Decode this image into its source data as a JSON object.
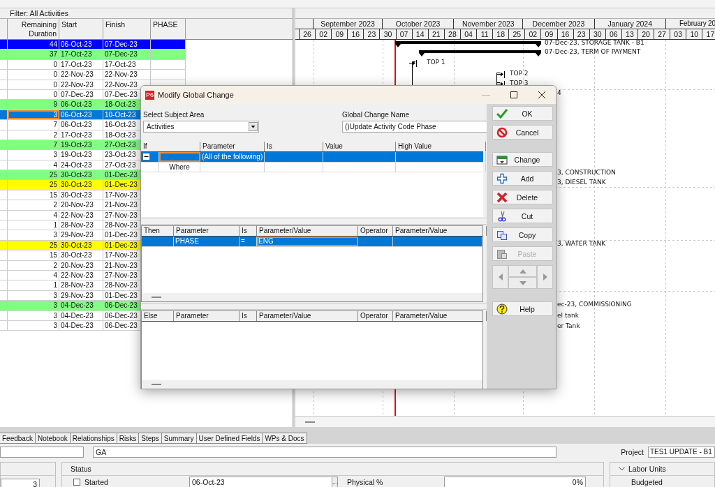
{
  "filter_bar": {
    "label": "Filter: All Activities"
  },
  "table": {
    "columns": [
      {
        "label": "Remaining Duration"
      },
      {
        "label": "Start"
      },
      {
        "label": "Finish"
      },
      {
        "label": "PHASE"
      }
    ],
    "rows": [
      {
        "remaining": "44",
        "start": "06-Oct-23",
        "finish": "07-Dec-23",
        "color": "#0000ff",
        "selected": false
      },
      {
        "remaining": "37",
        "start": "17-Oct-23",
        "finish": "07-Dec-23",
        "color": "#80ff80",
        "selected": false
      },
      {
        "remaining": "0",
        "start": "17-Oct-23",
        "finish": "17-Oct-23",
        "selected": false
      },
      {
        "remaining": "0",
        "start": "22-Nov-23",
        "finish": "22-Nov-23",
        "selected": false
      },
      {
        "remaining": "0",
        "start": "22-Nov-23",
        "finish": "22-Nov-23",
        "selected": false
      },
      {
        "remaining": "0",
        "start": "07-Dec-23",
        "finish": "07-Dec-23",
        "selected": false
      },
      {
        "remaining": "9",
        "start": "06-Oct-23",
        "finish": "18-Oct-23",
        "color": "#80ff80",
        "selected": false
      },
      {
        "remaining": "3",
        "start": "06-Oct-23",
        "finish": "10-Oct-23",
        "selected": true
      },
      {
        "remaining": "7",
        "start": "06-Oct-23",
        "finish": "16-Oct-23",
        "selected": false
      },
      {
        "remaining": "2",
        "start": "17-Oct-23",
        "finish": "18-Oct-23",
        "selected": false
      },
      {
        "remaining": "7",
        "start": "19-Oct-23",
        "finish": "27-Oct-23",
        "color": "#80ff80",
        "selected": false
      },
      {
        "remaining": "3",
        "start": "19-Oct-23",
        "finish": "23-Oct-23",
        "selected": false
      },
      {
        "remaining": "4",
        "start": "24-Oct-23",
        "finish": "27-Oct-23",
        "selected": false
      },
      {
        "remaining": "25",
        "start": "30-Oct-23",
        "finish": "01-Dec-23",
        "color": "#80ff80",
        "selected": false
      },
      {
        "remaining": "25",
        "start": "30-Oct-23",
        "finish": "01-Dec-23",
        "color": "#ffff00",
        "selected": false
      },
      {
        "remaining": "15",
        "start": "30-Oct-23",
        "finish": "17-Nov-23",
        "selected": false
      },
      {
        "remaining": "2",
        "start": "20-Nov-23",
        "finish": "21-Nov-23",
        "selected": false
      },
      {
        "remaining": "4",
        "start": "22-Nov-23",
        "finish": "27-Nov-23",
        "selected": false
      },
      {
        "remaining": "1",
        "start": "28-Nov-23",
        "finish": "28-Nov-23",
        "selected": false
      },
      {
        "remaining": "3",
        "start": "29-Nov-23",
        "finish": "01-Dec-23",
        "selected": false
      },
      {
        "remaining": "25",
        "start": "30-Oct-23",
        "finish": "01-Dec-23",
        "color": "#ffff00",
        "selected": false
      },
      {
        "remaining": "15",
        "start": "30-Oct-23",
        "finish": "17-Nov-23",
        "selected": false
      },
      {
        "remaining": "2",
        "start": "20-Nov-23",
        "finish": "21-Nov-23",
        "selected": false
      },
      {
        "remaining": "4",
        "start": "22-Nov-23",
        "finish": "27-Nov-23",
        "selected": false
      },
      {
        "remaining": "1",
        "start": "28-Nov-23",
        "finish": "28-Nov-23",
        "selected": false
      },
      {
        "remaining": "3",
        "start": "29-Nov-23",
        "finish": "01-Dec-23",
        "selected": false
      },
      {
        "remaining": "3",
        "start": "04-Dec-23",
        "finish": "06-Dec-23",
        "color": "#80ff80",
        "selected": false
      },
      {
        "remaining": "3",
        "start": "04-Dec-23",
        "finish": "06-Dec-23",
        "selected": false
      },
      {
        "remaining": "3",
        "start": "04-Dec-23",
        "finish": "06-Dec-23",
        "selected": false
      }
    ]
  },
  "gantt": {
    "months": [
      "September 2023",
      "October 2023",
      "November 2023",
      "December 2023",
      "January 2024",
      "February 20"
    ],
    "weeks": [
      "26",
      "02",
      "09",
      "16",
      "23",
      "30",
      "07",
      "14",
      "21",
      "28",
      "04",
      "11",
      "18",
      "25",
      "02",
      "09",
      "16",
      "23",
      "30",
      "06",
      "13",
      "20",
      "27",
      "03",
      "10",
      "17"
    ],
    "items": [
      {
        "kind": "summary",
        "label": "07-Dec-23, STORAGE TANK - B1"
      },
      {
        "kind": "summary",
        "label": "07-Dec-23, TERM OF PAYMENT"
      },
      {
        "kind": "milestone",
        "label": "TOP 1"
      },
      {
        "kind": "milestone",
        "label": "TOP 2"
      },
      {
        "kind": "milestone",
        "label": "TOP 3"
      },
      {
        "kind": "label",
        "label": "4"
      },
      {
        "kind": "label",
        "label": "3, CONSTRUCTION"
      },
      {
        "kind": "label",
        "label": "3, DIESEL TANK"
      },
      {
        "kind": "label",
        "label": "3, WATER TANK"
      },
      {
        "kind": "label",
        "label": "ec-23, COMMISSIONING"
      },
      {
        "kind": "label",
        "label": "el tank"
      },
      {
        "kind": "label",
        "label": "er Tank"
      }
    ]
  },
  "dialog": {
    "app_badge": "P6",
    "title": "Modify Global Change",
    "subject_area": {
      "label": "Select Subject Area",
      "value": "Activities"
    },
    "name_field": {
      "label": "Global Change Name",
      "value": "()Update Activity Code Phase"
    },
    "if_grid": {
      "columns": [
        "If",
        "Parameter",
        "Is",
        "Value",
        "High Value"
      ],
      "rows": [
        {
          "kind": "group",
          "expanded": true,
          "selected": true,
          "parameter": "(All of the following)"
        },
        {
          "kind": "condition",
          "selected": false,
          "label": "Where"
        }
      ]
    },
    "then_grid": {
      "columns": [
        "Then",
        "Parameter",
        "Is",
        "Parameter/Value",
        "Operator",
        "Parameter/Value"
      ],
      "rows": [
        {
          "selected": true,
          "parameter": "PHASE",
          "is": "=",
          "value": "ENG"
        }
      ]
    },
    "else_grid": {
      "columns": [
        "Else",
        "Parameter",
        "Is",
        "Parameter/Value",
        "Operator",
        "Parameter/Value"
      ]
    },
    "buttons_top": [
      {
        "kind": "ok",
        "label": "OK",
        "disabled": false
      },
      {
        "kind": "cancel",
        "label": "Cancel",
        "disabled": false
      }
    ],
    "buttons_edit": [
      {
        "kind": "change",
        "label": "Change",
        "disabled": false
      },
      {
        "kind": "add",
        "label": "Add",
        "disabled": false
      },
      {
        "kind": "delete",
        "label": "Delete",
        "disabled": false
      },
      {
        "kind": "cut",
        "label": "Cut",
        "disabled": false
      },
      {
        "kind": "copy",
        "label": "Copy",
        "disabled": false
      },
      {
        "kind": "paste",
        "label": "Paste",
        "disabled": true
      }
    ],
    "help_button": {
      "label": "Help",
      "disabled": false
    }
  },
  "detail_tabs": [
    {
      "label": "Feedback"
    },
    {
      "label": "Notebook"
    },
    {
      "label": "Relationships"
    },
    {
      "label": "Risks"
    },
    {
      "label": "Steps"
    },
    {
      "label": "Summary"
    },
    {
      "label": "User Defined Fields"
    },
    {
      "label": "WPs & Docs"
    }
  ],
  "detail": {
    "activity_name": "GA",
    "project": {
      "label": "Project",
      "value": "TES1 UPDATE - B1"
    },
    "duration_value": "3",
    "status": {
      "title": "Status",
      "started": {
        "label": "Started",
        "checked": false
      },
      "start_date": "06-Oct-23",
      "date_button": "...",
      "physical": {
        "label": "Physical %",
        "value": "0%"
      }
    },
    "labor_units": {
      "title": "Labor Units",
      "expanded": true,
      "budgeted": "Budgeted"
    }
  }
}
